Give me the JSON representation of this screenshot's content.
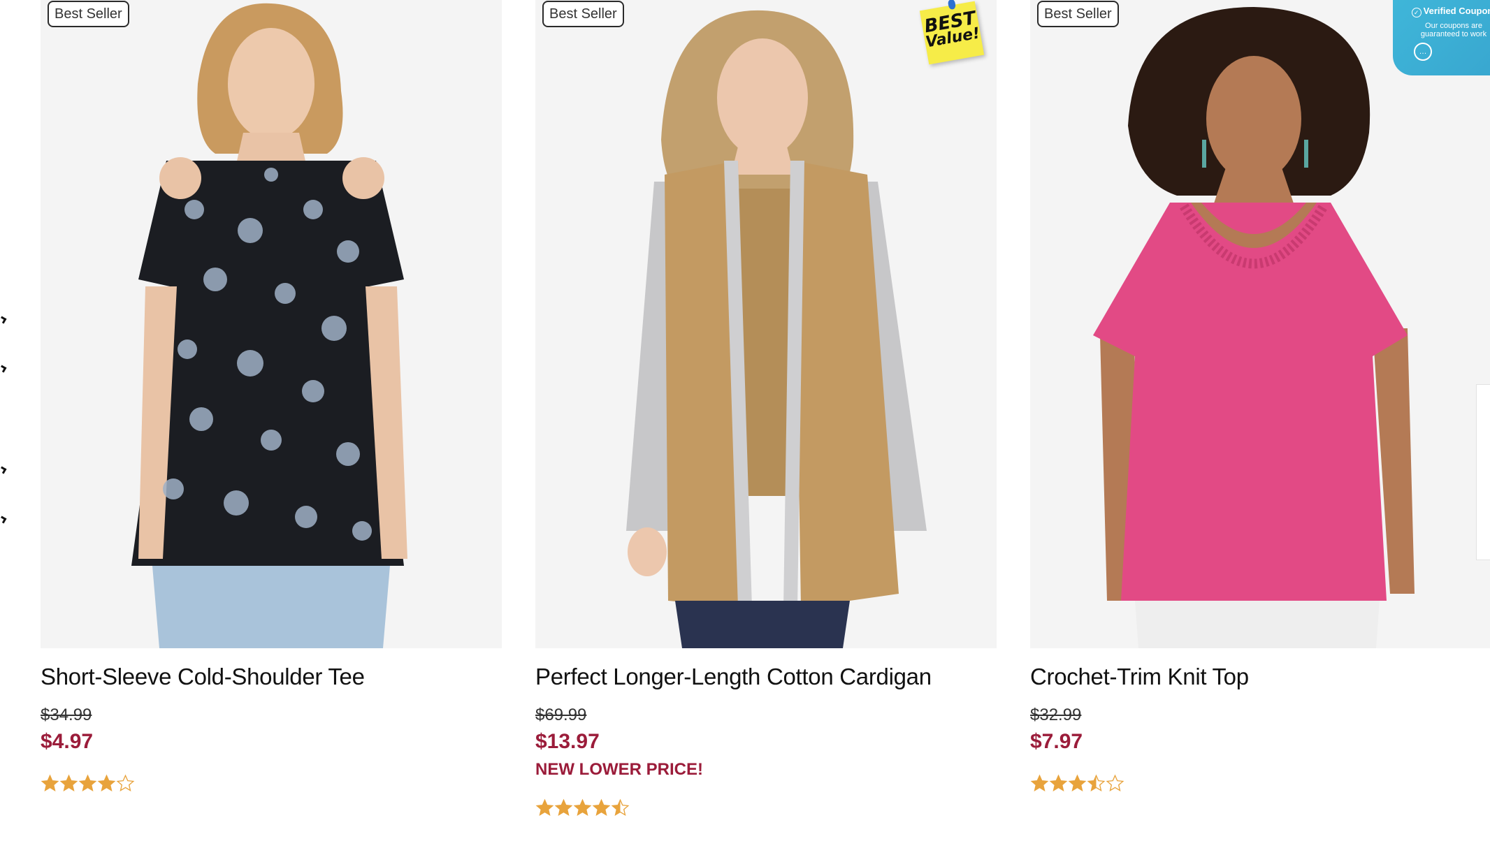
{
  "products": [
    {
      "badge": "Best Seller",
      "title": "Short-Sleeve Cold-Shoulder Tee",
      "original_price": "$34.99",
      "sale_price": "$4.97",
      "promo": "",
      "rating": 4,
      "image_colors": {
        "top": "#1b1d22",
        "print": "#9fb0c6",
        "skin": "#e9c3a6",
        "pants": "#a9c3da"
      }
    },
    {
      "badge": "Best Seller",
      "sticker": {
        "line1": "BEST",
        "line2": "Value!"
      },
      "title": "Perfect Longer-Length Cotton Cardigan",
      "original_price": "$69.99",
      "sale_price": "$13.97",
      "promo": "NEW LOWER PRICE!",
      "rating": 4.5,
      "image_colors": {
        "vest": "#c39a62",
        "sleeve": "#c7c7c9",
        "trim": "#cfcfd1",
        "pants": "#2a3350",
        "skin": "#ecc7ad"
      }
    },
    {
      "badge": "Best Seller",
      "title": "Crochet-Trim Knit Top",
      "original_price": "$32.99",
      "sale_price": "$7.97",
      "promo": "",
      "rating": 3.5,
      "image_colors": {
        "top": "#e24a85",
        "hair": "#2b1a12",
        "skin": "#b47a55",
        "pants": "#eeeeee"
      }
    }
  ],
  "coupon": {
    "title": "Verified Coupon",
    "subtitle_line1": "Our coupons are",
    "subtitle_line2": "guaranteed to work"
  },
  "theme": {
    "price_red": "#9b1c3a",
    "star_orange": "#e8a33c"
  }
}
